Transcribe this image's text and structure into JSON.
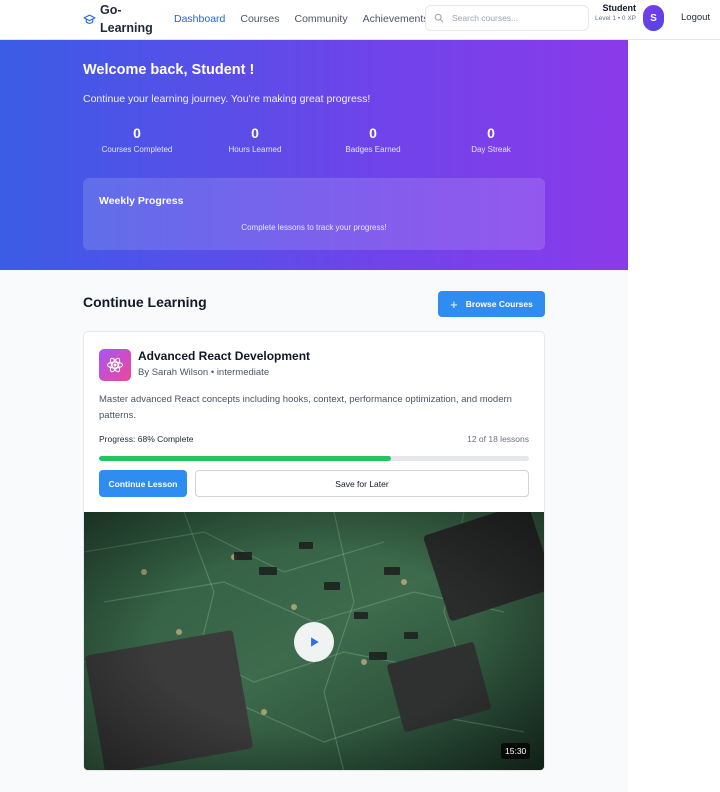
{
  "header": {
    "brand": "Go-Learning",
    "nav": [
      {
        "label": "Dashboard",
        "active": true
      },
      {
        "label": "Courses"
      },
      {
        "label": "Community"
      },
      {
        "label": "Achievements"
      }
    ],
    "search_placeholder": "Search courses...",
    "user_name": "Student",
    "user_level": "Level 1 • 0 XP",
    "avatar_initial": "S",
    "logout_label": "Logout"
  },
  "hero": {
    "title": "Welcome back, Student !",
    "subtitle": "Continue your learning journey. You're making great progress!",
    "stats": [
      {
        "value": "0",
        "label": "Courses Completed"
      },
      {
        "value": "0",
        "label": "Hours Learned"
      },
      {
        "value": "0",
        "label": "Badges Earned"
      },
      {
        "value": "0",
        "label": "Day Streak"
      }
    ],
    "weekly_title": "Weekly Progress",
    "weekly_message": "Complete lessons to track your progress!"
  },
  "main": {
    "section_title": "Continue Learning",
    "browse_label": "Browse Courses",
    "course": {
      "title": "Advanced React Development",
      "meta": "By Sarah Wilson • intermediate",
      "description": "Master advanced React concepts including hooks, context, performance optimization, and modern patterns.",
      "progress_label": "Progress: 68% Complete",
      "progress_percent": 68,
      "lessons_label": "12 of 18 lessons",
      "continue_label": "Continue Lesson",
      "save_label": "Save for Later",
      "video_duration": "15:30"
    }
  },
  "colors": {
    "accent": "#2f8cf0",
    "progress": "#22c55e",
    "hero_start": "#3b5ce6",
    "hero_end": "#8b3aea"
  }
}
